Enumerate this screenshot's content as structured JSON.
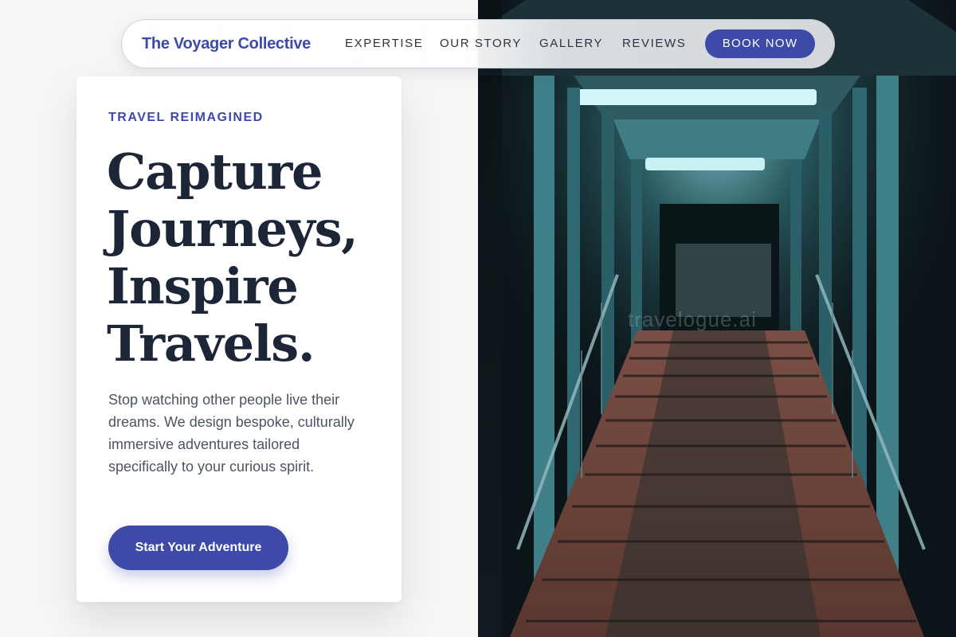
{
  "nav": {
    "brand": "The Voyager Collective",
    "links": [
      "EXPERTISE",
      "OUR STORY",
      "GALLERY",
      "REVIEWS"
    ],
    "cta": "BOOK NOW"
  },
  "hero": {
    "eyebrow": "TRAVEL REIMAGINED",
    "headline_lines": [
      "Capture",
      "Journeys,",
      "Inspire",
      "Travels."
    ],
    "description": "Stop watching other people live their dreams. We design bespoke, culturally immersive adventures tailored specifically to your curious spirit.",
    "cta": "Start Your Adventure"
  },
  "photo": {
    "watermark": "travelogue.ai"
  },
  "colors": {
    "accent": "#3d4aa8",
    "heading": "#1c2636",
    "body_text": "#4c5462",
    "page_bg": "#f6f6f7"
  }
}
